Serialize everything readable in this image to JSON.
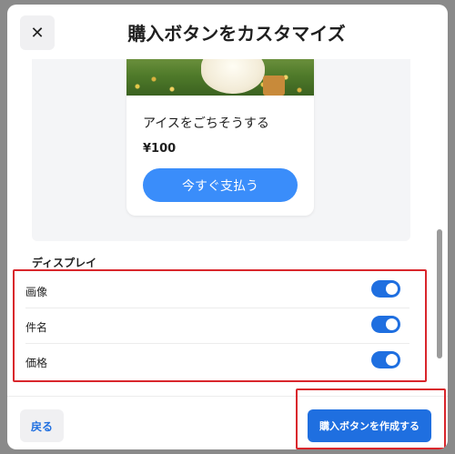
{
  "modal": {
    "title": "購入ボタンをカスタマイズ",
    "close_icon_glyph": "✕"
  },
  "preview": {
    "product_name": "アイスをごちそうする",
    "price": "¥100",
    "pay_button_label": "今すぐ支払う"
  },
  "display": {
    "section_label": "ディスプレイ",
    "rows": [
      {
        "label": "画像",
        "enabled": true
      },
      {
        "label": "件名",
        "enabled": true
      },
      {
        "label": "価格",
        "enabled": true
      }
    ]
  },
  "footer": {
    "back_label": "戻る",
    "create_label": "購入ボタンを作成する"
  },
  "colors": {
    "accent": "#1f6fe0",
    "pay_button": "#3a8dfa",
    "highlight": "#d9262c"
  }
}
